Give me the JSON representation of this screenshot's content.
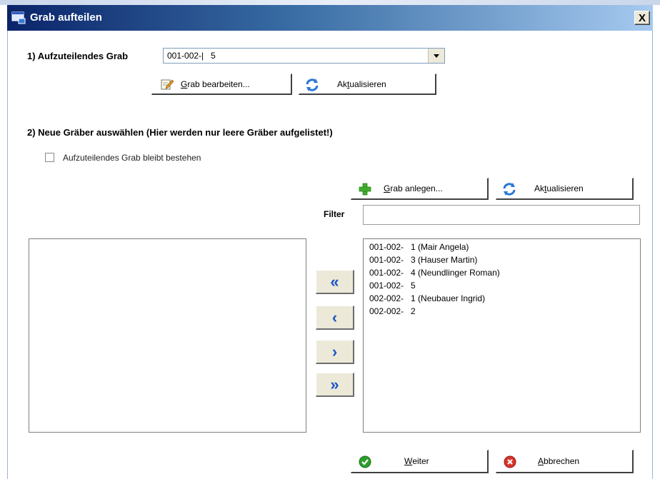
{
  "window": {
    "title": "Grab aufteilen",
    "close_glyph": "X"
  },
  "section1": {
    "label": "1) Aufzuteilendes Grab",
    "combo_value": "001-002-|   5",
    "edit_button": {
      "accel": "G",
      "label_rest": "rab bearbeiten...",
      "icon": "edit-pencil-icon"
    },
    "refresh_button": {
      "pre": "Ak",
      "accel": "t",
      "post": "ualisieren",
      "icon": "refresh-icon"
    }
  },
  "section2": {
    "label": "2) Neue Gräber auswählen (Hier werden nur leere Gräber aufgelistet!)",
    "checkbox_label": "Aufzuteilendes Grab bleibt bestehen",
    "checkbox_checked": false,
    "add_button": {
      "accel": "G",
      "label_rest": "rab anlegen...",
      "icon": "plus-icon"
    },
    "refresh_button": {
      "pre": "Ak",
      "accel": "t",
      "post": "ualisieren",
      "icon": "refresh-icon"
    },
    "filter_label": "Filter",
    "filter_value": "",
    "left_list": [],
    "right_list": [
      "001-002-   1 (Mair Angela)",
      "001-002-   3 (Hauser Martin)",
      "001-002-   4 (Neundlinger Roman)",
      "001-002-   5",
      "002-002-   1 (Neubauer Ingrid)",
      "002-002-   2"
    ],
    "transfer_buttons": [
      "«",
      "‹",
      "›",
      "»"
    ]
  },
  "footer": {
    "next_button": {
      "accel": "W",
      "label_rest": "eiter",
      "icon": "check-icon"
    },
    "cancel_button": {
      "accel": "A",
      "label_rest": "bbrechen",
      "icon": "cancel-icon"
    }
  },
  "colors": {
    "title_start": "#0a246a",
    "title_end": "#a6caf0",
    "accent_blue": "#1a55c8",
    "check_green": "#2e9e2e",
    "cancel_red": "#d9342b"
  }
}
